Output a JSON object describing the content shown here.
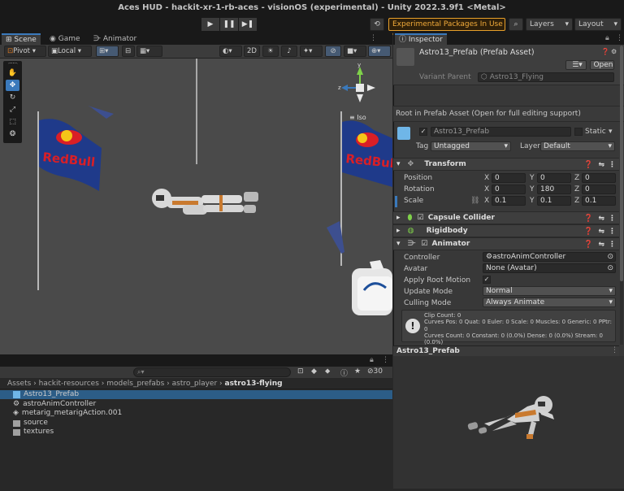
{
  "window": {
    "title": "Aces HUD - hackit-xr-1-rb-aces - visionOS (experimental) - Unity 2022.3.9f1 <Metal>"
  },
  "toolbar": {
    "play": "▶",
    "pause": "❚❚",
    "step": "▶❚",
    "experimental": "Experimental Packages In Use ▾",
    "layers": "Layers",
    "layout": "Layout"
  },
  "tabs": {
    "scene": "Scene",
    "game": "Game",
    "animator": "Animator"
  },
  "scene_toolbar": {
    "pivot": "Pivot",
    "local": "Local",
    "twod": "2D",
    "iso": "Iso"
  },
  "project": {
    "count": "30",
    "breadcrumb": [
      "Assets",
      "hackit-resources",
      "models_prefabs",
      "astro_player",
      "astro13-flying"
    ],
    "files": [
      {
        "name": "Astro13_Prefab",
        "icon": "prefab-icon",
        "selected": true
      },
      {
        "name": "astroAnimController",
        "icon": "animator-controller-icon",
        "selected": false
      },
      {
        "name": "metarig_metarigAction.001",
        "icon": "animation-clip-icon",
        "selected": false
      },
      {
        "name": "source",
        "icon": "folder-icon",
        "selected": false
      },
      {
        "name": "textures",
        "icon": "folder-icon",
        "selected": false
      }
    ]
  },
  "inspector": {
    "tab": "Inspector",
    "asset_title": "Astro13_Prefab (Prefab Asset)",
    "open": "Open",
    "variant_parent_label": "Variant Parent",
    "variant_parent_value": "Astro13_Flying",
    "root_note": "Root in Prefab Asset (Open for full editing support)",
    "object_name": "Astro13_Prefab",
    "static_label": "Static",
    "tag_label": "Tag",
    "tag_value": "Untagged",
    "layer_label": "Layer",
    "layer_value": "Default",
    "transform": {
      "title": "Transform",
      "position": {
        "label": "Position",
        "x": "0",
        "y": "0",
        "z": "0"
      },
      "rotation": {
        "label": "Rotation",
        "x": "0",
        "y": "180",
        "z": "0"
      },
      "scale": {
        "label": "Scale",
        "x": "0.1",
        "y": "0.1",
        "z": "0.1"
      }
    },
    "capsule": "Capsule Collider",
    "rigidbody": "Rigidbody",
    "animator": {
      "title": "Animator",
      "controller_label": "Controller",
      "controller_value": "astroAnimController",
      "avatar_label": "Avatar",
      "avatar_value": "None (Avatar)",
      "root_motion_label": "Apply Root Motion",
      "update_label": "Update Mode",
      "update_value": "Normal",
      "culling_label": "Culling Mode",
      "culling_value": "Always Animate",
      "info": [
        "Clip Count: 0",
        "Curves Pos: 0 Quat: 0 Euler: 0 Scale: 0 Muscles: 0 Generic: 0 PPtr: 0",
        "Curves Count: 0 Constant: 0 (0.0%) Dense: 0 (0.0%) Stream: 0",
        "(0.0%)"
      ]
    },
    "preview_title": "Astro13_Prefab"
  },
  "colors": {
    "accent": "#3a79bb",
    "warning": "#f2ab3a",
    "selection": "#2c5d87"
  }
}
